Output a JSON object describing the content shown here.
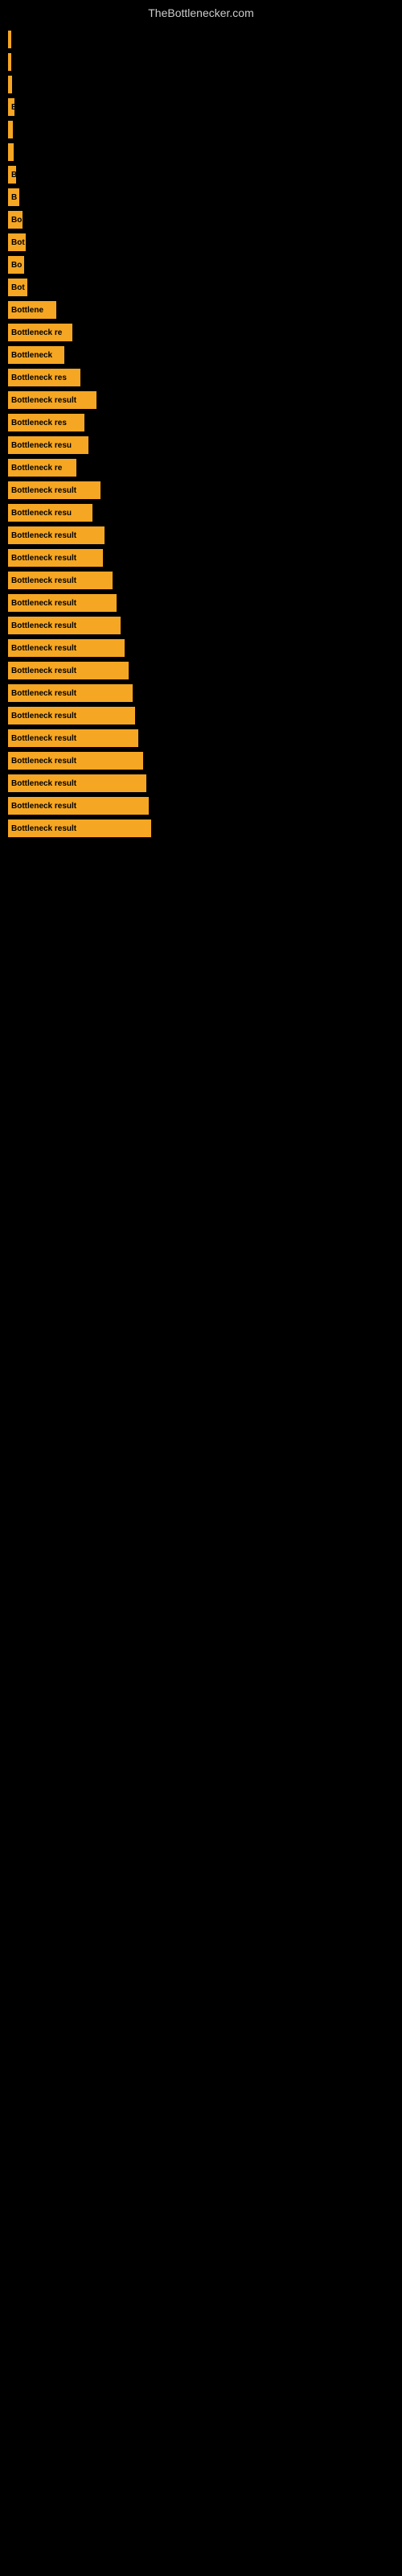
{
  "site": {
    "title": "TheBottlenecker.com"
  },
  "bars": [
    {
      "width": 2,
      "label": ""
    },
    {
      "width": 4,
      "label": ""
    },
    {
      "width": 5,
      "label": ""
    },
    {
      "width": 8,
      "label": "B"
    },
    {
      "width": 6,
      "label": ""
    },
    {
      "width": 7,
      "label": ""
    },
    {
      "width": 10,
      "label": "B"
    },
    {
      "width": 14,
      "label": "B"
    },
    {
      "width": 18,
      "label": "Bo"
    },
    {
      "width": 22,
      "label": "Bot"
    },
    {
      "width": 20,
      "label": "Bo"
    },
    {
      "width": 24,
      "label": "Bot"
    },
    {
      "width": 60,
      "label": "Bottlene"
    },
    {
      "width": 80,
      "label": "Bottleneck re"
    },
    {
      "width": 70,
      "label": "Bottleneck"
    },
    {
      "width": 90,
      "label": "Bottleneck res"
    },
    {
      "width": 110,
      "label": "Bottleneck result"
    },
    {
      "width": 95,
      "label": "Bottleneck res"
    },
    {
      "width": 100,
      "label": "Bottleneck resu"
    },
    {
      "width": 85,
      "label": "Bottleneck re"
    },
    {
      "width": 115,
      "label": "Bottleneck result"
    },
    {
      "width": 105,
      "label": "Bottleneck resu"
    },
    {
      "width": 120,
      "label": "Bottleneck result"
    },
    {
      "width": 118,
      "label": "Bottleneck result"
    },
    {
      "width": 130,
      "label": "Bottleneck result"
    },
    {
      "width": 135,
      "label": "Bottleneck result"
    },
    {
      "width": 140,
      "label": "Bottleneck result"
    },
    {
      "width": 145,
      "label": "Bottleneck result"
    },
    {
      "width": 150,
      "label": "Bottleneck result"
    },
    {
      "width": 155,
      "label": "Bottleneck result"
    },
    {
      "width": 158,
      "label": "Bottleneck result"
    },
    {
      "width": 162,
      "label": "Bottleneck result"
    },
    {
      "width": 168,
      "label": "Bottleneck result"
    },
    {
      "width": 172,
      "label": "Bottleneck result"
    },
    {
      "width": 175,
      "label": "Bottleneck result"
    },
    {
      "width": 178,
      "label": "Bottleneck result"
    }
  ]
}
